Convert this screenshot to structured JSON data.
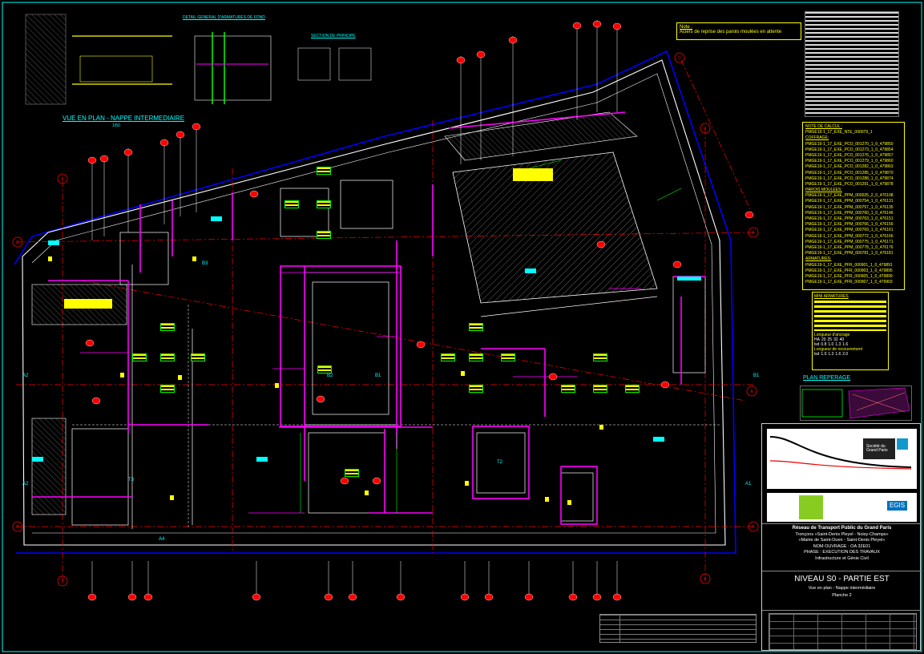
{
  "drawing": {
    "view_title": "VUE EN PLAN - NAPPE INTERMEDIAIRE",
    "view_scale": "1/50",
    "detail_titles": [
      "DETAIL GENERAL D'ARMATURES DE FOND",
      "SECTION DE PRINCIPE"
    ],
    "note_title": "Note :",
    "note_text": "Aciers de reprise des parois moulées en attente",
    "plan_reperage_label": "PLAN REPERAGE"
  },
  "schedule": {
    "title": "NOTE DE CALCUL :",
    "calc_ref": "PMGE19-1_17_EXE_NTE_000079_1",
    "coffrage_label": "COFFRAGE:",
    "coffrage_refs": [
      "PMGE19-1_17_EXE_PCO_001270_1_0_479850",
      "PMGE19-1_17_EXE_PCO_001273_1_0_479854",
      "PMGE19-1_17_EXE_PCO_001276_1_0_479857",
      "PMGE19-1_17_EXE_PCO_001279_1_0_479860",
      "PMGE19-1_17_EXE_PCO_001282_1_0_479863",
      "PMGE19-1_17_EXE_PCO_001285_1_0_479870",
      "PMGE19-1_17_EXE_PCO_001288_1_0_479874",
      "PMGE19-1_17_EXE_PCO_001291_1_0_479878"
    ],
    "parois_label": "PAROIS MOULEES:",
    "parois_refs": [
      "PMGE19-1_17_EXE_PPM_000025_2_0_470108",
      "PMGE19-1_17_EXE_PPM_000754_1_0_476131",
      "PMGE19-1_17_EXE_PPM_000757_1_0_476135",
      "PMGE19-1_17_EXE_PPM_000760_1_0_476146",
      "PMGE19-1_17_EXE_PPM_000763_1_0_476151",
      "PMGE19-1_17_EXE_PPM_000766_1_0_476156",
      "PMGE19-1_17_EXE_PPM_000769_1_0_476161",
      "PMGE19-1_17_EXE_PPM_000772_1_0_476166",
      "PMGE19-1_17_EXE_PPM_000775_1_0_476171",
      "PMGE19-1_17_EXE_PPM_000778_1_0_476176",
      "PMGE19-1_17_EXE_PPM_000781_1_0_476181"
    ],
    "armatures_label": "ARMATURES:",
    "armatures_refs": [
      "PMGE19-1_17_EXE_PFR_000901_1_0_479891",
      "PMGE19-1_17_EXE_PFR_000903_1_0_479895",
      "PMGE19-1_17_EXE_PFR_000905_1_0_479899",
      "PMGE19-1_17_EXE_PFR_000907_1_0_479903"
    ],
    "mini_title": "MINI ARMATURES",
    "longueur_ancrage": "Longueur d'ancrage",
    "longueur_recouvrement": "Longueur de recouvrement",
    "diameters": [
      "HA",
      "20",
      "25",
      "32",
      "40"
    ],
    "ancrage_values": [
      "lsd",
      "0.8",
      "1.0",
      "1.3",
      "1.6"
    ],
    "recouvrement_values": [
      "lsd",
      "1.0",
      "1.3",
      "1.6",
      "2.0"
    ]
  },
  "title_block": {
    "client_logo_text": "Société du Grand Paris",
    "contractor_badge": "EGIS",
    "project": "Réseau de Transport Public du Grand Paris",
    "line1": "Tronçons «Saint-Denis Pleyel - Noisy-Champs»",
    "line2": "«Mairie de Saint-Ouen - Saint-Denis Pleyel»",
    "line3": "NOM OUVRAGE : OA 32E01",
    "line4": "PHASE : EXECUTION DES TRAVAUX",
    "line5": "Infrastructure et Génie Civil",
    "level_title": "NIVEAU S0 - PARTIE EST",
    "subtitle": "Vue en plan - Nappe intermédiaire",
    "sheet": "Planche 2"
  },
  "grid_labels": {
    "letters": [
      "A",
      "B",
      "C",
      "D",
      "E"
    ],
    "numbers": [
      "1",
      "2",
      "3",
      "4",
      "5",
      "6"
    ],
    "zones": [
      "A1",
      "A2",
      "A3",
      "B1",
      "B2",
      "B3",
      "B4",
      "T1",
      "T2",
      "T3"
    ]
  },
  "colors": {
    "background": "#000000",
    "wall": "#ffffff",
    "axis": "#ff0000",
    "rebar": "#ff00ff",
    "annotation": "#ffff00",
    "dimension": "#00ff00",
    "border": "#00ffff",
    "excavation": "#0000ff"
  }
}
